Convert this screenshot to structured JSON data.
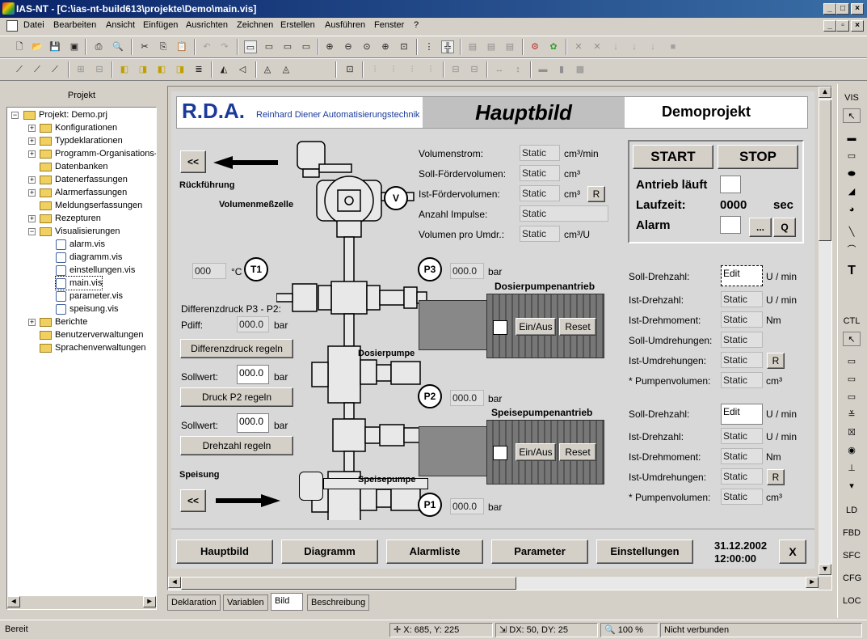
{
  "window": {
    "title": "IAS-NT - [C:\\ias-nt-build613\\projekte\\Demo\\main.vis]"
  },
  "menu": [
    "Datei",
    "Bearbeiten",
    "Ansicht",
    "Einfügen",
    "Ausrichten",
    "Zeichnen",
    "Erstellen",
    "Ausführen",
    "Fenster",
    "?"
  ],
  "project_panel": {
    "title": "Projekt",
    "items": [
      {
        "label": "Projekt: Demo.prj"
      },
      {
        "label": "Konfigurationen"
      },
      {
        "label": "Typdeklarationen"
      },
      {
        "label": "Programm-Organisations-"
      },
      {
        "label": "Datenbanken"
      },
      {
        "label": "Datenerfassungen"
      },
      {
        "label": "Alarmerfassungen"
      },
      {
        "label": "Meldungserfassungen"
      },
      {
        "label": "Rezepturen"
      },
      {
        "label": "Visualisierungen"
      },
      {
        "label": "alarm.vis"
      },
      {
        "label": "diagramm.vis"
      },
      {
        "label": "einstellungen.vis"
      },
      {
        "label": "main.vis"
      },
      {
        "label": "parameter.vis"
      },
      {
        "label": "speisung.vis"
      },
      {
        "label": "Berichte"
      },
      {
        "label": "Benutzerverwaltungen"
      },
      {
        "label": "Sprachenverwaltungen"
      }
    ]
  },
  "hmi": {
    "logo": "R.D.A.",
    "company": "Reinhard Diener Automatisierungstechnik",
    "title": "Hauptbild",
    "project": "Demoprojekt",
    "back_label": "<<",
    "rueckfuehrung": "Rückführung",
    "volumenmesszelle": "Volumenmeßzelle",
    "speisung": "Speisung",
    "dosierpumpe": "Dosierpumpe",
    "speisepumpe": "Speisepumpe",
    "dosierpumpenantrieb": "Dosierpumpenantrieb",
    "speisepumpenantrieb": "Speisepumpenantrieb",
    "einaus": "Ein/Aus",
    "reset": "Reset",
    "volumenstrom": "Volumenstrom:",
    "soll_foerder": "Soll-Fördervolumen:",
    "ist_foerder": "Ist-Fördervolumen:",
    "impulse": "Anzahl Impulse:",
    "vol_umdr": "Volumen pro Umdr.:",
    "static": "Static",
    "edit": "Edit",
    "unit_cm3min": "cm³/min",
    "unit_cm3": "cm³",
    "unit_cm3u": "cm³/U",
    "unit_umin": "U / min",
    "unit_nm": "Nm",
    "unit_bar": "bar",
    "unit_c": "°C",
    "unit_sec": "sec",
    "r": "R",
    "start": "START",
    "stop": "STOP",
    "antrieb": "Antrieb läuft",
    "laufzeit": "Laufzeit:",
    "laufzeit_val": "0000",
    "alarm": "Alarm",
    "dots": "...",
    "q": "Q",
    "t1": "T1",
    "p1": "P1",
    "p2": "P2",
    "p3": "P3",
    "v": "V",
    "val000": "000",
    "val0000": "000.0",
    "diffdruck": "Differenzdruck P3 - P2:",
    "pdiff": "Pdiff:",
    "btn_diff": "Differenzdruck regeln",
    "btn_p2": "Druck P2 regeln",
    "btn_drehzahl": "Drehzahl regeln",
    "sollwert": "Sollwert:",
    "soll_drehzahl": "Soll-Drehzahl:",
    "ist_drehzahl": "Ist-Drehzahl:",
    "ist_drehmoment": "Ist-Drehmoment:",
    "soll_umdr": "Soll-Umdrehungen:",
    "ist_umdr": "Ist-Umdrehungen:",
    "pumpenvol": "* Pumpenvolumen:",
    "nav": [
      "Hauptbild",
      "Diagramm",
      "Alarmliste",
      "Parameter",
      "Einstellungen"
    ],
    "date": "31.12.2002",
    "time": "12:00:00",
    "close": "X"
  },
  "tabs": [
    "Deklaration",
    "Variablen",
    "Bild",
    "Beschreibung"
  ],
  "right_toolbar": {
    "vis": "VIS",
    "ctl": "CTL",
    "ld": "LD",
    "fbd": "FBD",
    "sfc": "SFC",
    "cfg": "CFG",
    "loc": "LOC"
  },
  "status": {
    "ready": "Bereit",
    "pos": "X: 685, Y: 225",
    "delta": "DX: 50, DY: 25",
    "zoom": "100 %",
    "conn": "Nicht verbunden"
  }
}
